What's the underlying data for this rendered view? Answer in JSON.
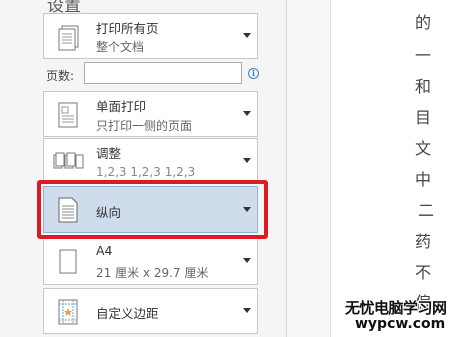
{
  "settings": {
    "title": "设置",
    "print_range": {
      "label": "打印所有页",
      "sub": "整个文档"
    },
    "pages": {
      "label": "页数:",
      "value": "",
      "info_icon": "i"
    },
    "sides": {
      "label": "单面打印",
      "sub": "只打印一侧的页面"
    },
    "collate": {
      "label": "调整",
      "sub": "1,2,3    1,2,3    1,2,3"
    },
    "orientation": {
      "label": "纵向"
    },
    "paper": {
      "label": "A4",
      "sub": "21 厘米 x 29.7 厘米"
    },
    "margins": {
      "label": "自定义边距"
    }
  },
  "document_text": [
    "的",
    "一",
    "和",
    "目",
    "文",
    "中",
    "二",
    "药",
    "不",
    "偏"
  ],
  "watermark": {
    "line1": "无忧电脑学习网",
    "line2": "wypcw.com"
  },
  "colors": {
    "highlight": "#e01a22",
    "selected": "#cfdcec",
    "accent": "#3d80c8"
  }
}
